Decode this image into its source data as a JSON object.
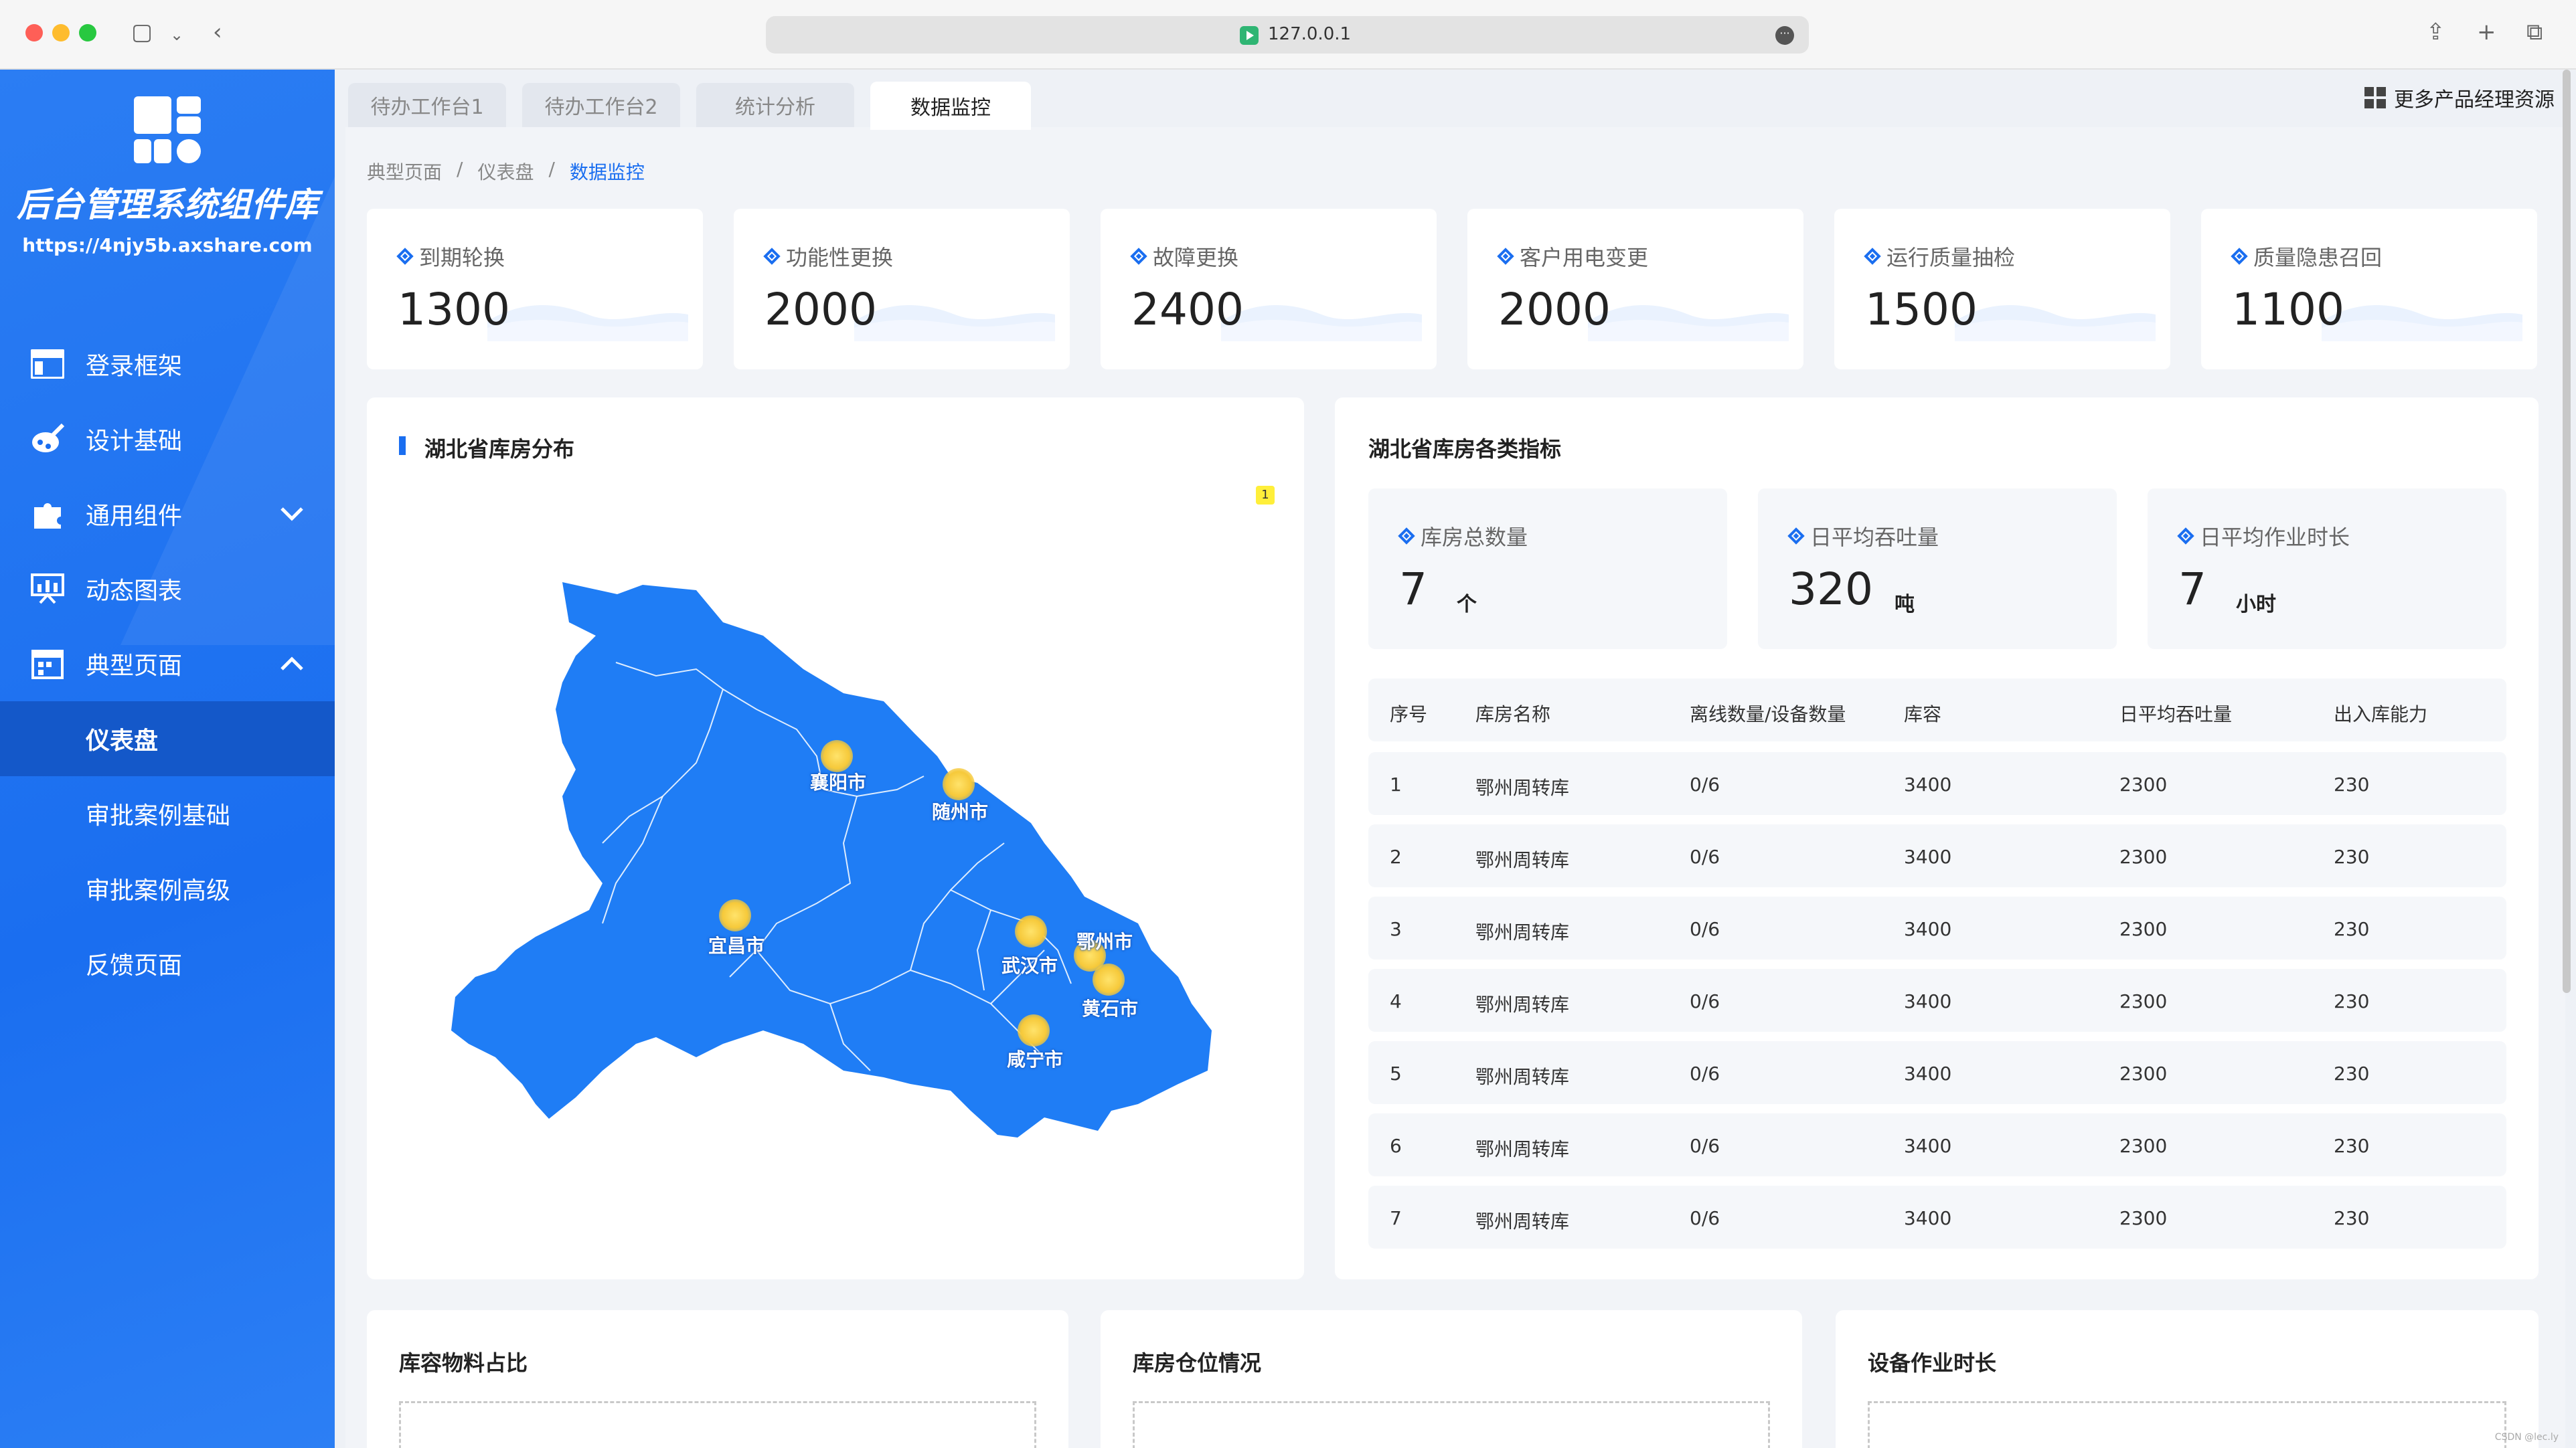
{
  "browser": {
    "url": "127.0.0.1"
  },
  "sidebar": {
    "brand": "后台管理系统组件库",
    "url": "https://4njy5b.axshare.com",
    "items": [
      {
        "label": "登录框架",
        "icon": "layout-icon"
      },
      {
        "label": "设计基础",
        "icon": "palette-icon"
      },
      {
        "label": "通用组件",
        "icon": "puzzle-icon",
        "chevron": "down"
      },
      {
        "label": "动态图表",
        "icon": "presentation-chart-icon"
      },
      {
        "label": "典型页面",
        "icon": "calendar-grid-icon",
        "chevron": "up"
      }
    ],
    "subitems": [
      {
        "label": "仪表盘",
        "active": true
      },
      {
        "label": "审批案例基础"
      },
      {
        "label": "审批案例高级"
      },
      {
        "label": "反馈页面"
      }
    ]
  },
  "tabs": [
    {
      "label": "待办工作台1"
    },
    {
      "label": "待办工作台2"
    },
    {
      "label": "统计分析"
    },
    {
      "label": "数据监控",
      "active": true
    }
  ],
  "more_resources": "更多产品经理资源",
  "breadcrumb": [
    "典型页面",
    "仪表盘",
    "数据监控"
  ],
  "stats": [
    {
      "label": "到期轮换",
      "value": "1300"
    },
    {
      "label": "功能性更换",
      "value": "2000"
    },
    {
      "label": "故障更换",
      "value": "2400"
    },
    {
      "label": "客户用电变更",
      "value": "2000"
    },
    {
      "label": "运行质量抽检",
      "value": "1500"
    },
    {
      "label": "质量隐患召回",
      "value": "1100"
    }
  ],
  "map_panel": {
    "title": "湖北省库房分布",
    "marker": "1",
    "cities": [
      "襄阳市",
      "随州市",
      "宜昌市",
      "鄂州市",
      "武汉市",
      "黄石市",
      "咸宁市"
    ]
  },
  "indicator_panel": {
    "title": "湖北省库房各类指标",
    "kpis": [
      {
        "label": "库房总数量",
        "value": "7",
        "unit": "个"
      },
      {
        "label": "日平均吞吐量",
        "value": "320",
        "unit": "吨"
      },
      {
        "label": "日平均作业时长",
        "value": "7",
        "unit": "小时"
      }
    ],
    "columns": [
      "序号",
      "库房名称",
      "离线数量/设备数量",
      "库容",
      "日平均吞吐量",
      "出入库能力"
    ],
    "rows": [
      [
        "1",
        "鄂州周转库",
        "0/6",
        "3400",
        "2300",
        "230"
      ],
      [
        "2",
        "鄂州周转库",
        "0/6",
        "3400",
        "2300",
        "230"
      ],
      [
        "3",
        "鄂州周转库",
        "0/6",
        "3400",
        "2300",
        "230"
      ],
      [
        "4",
        "鄂州周转库",
        "0/6",
        "3400",
        "2300",
        "230"
      ],
      [
        "5",
        "鄂州周转库",
        "0/6",
        "3400",
        "2300",
        "230"
      ],
      [
        "6",
        "鄂州周转库",
        "0/6",
        "3400",
        "2300",
        "230"
      ],
      [
        "7",
        "鄂州周转库",
        "0/6",
        "3400",
        "2300",
        "230"
      ]
    ]
  },
  "bottom_panels": [
    {
      "title": "库容物料占比"
    },
    {
      "title": "库房仓位情况"
    },
    {
      "title": "设备作业时长"
    }
  ],
  "watermark": "CSDN @lec.ly",
  "colors": {
    "primary": "#1a6ef0",
    "map_fill": "#1f7df5",
    "city_dot": "#f6c93a"
  }
}
